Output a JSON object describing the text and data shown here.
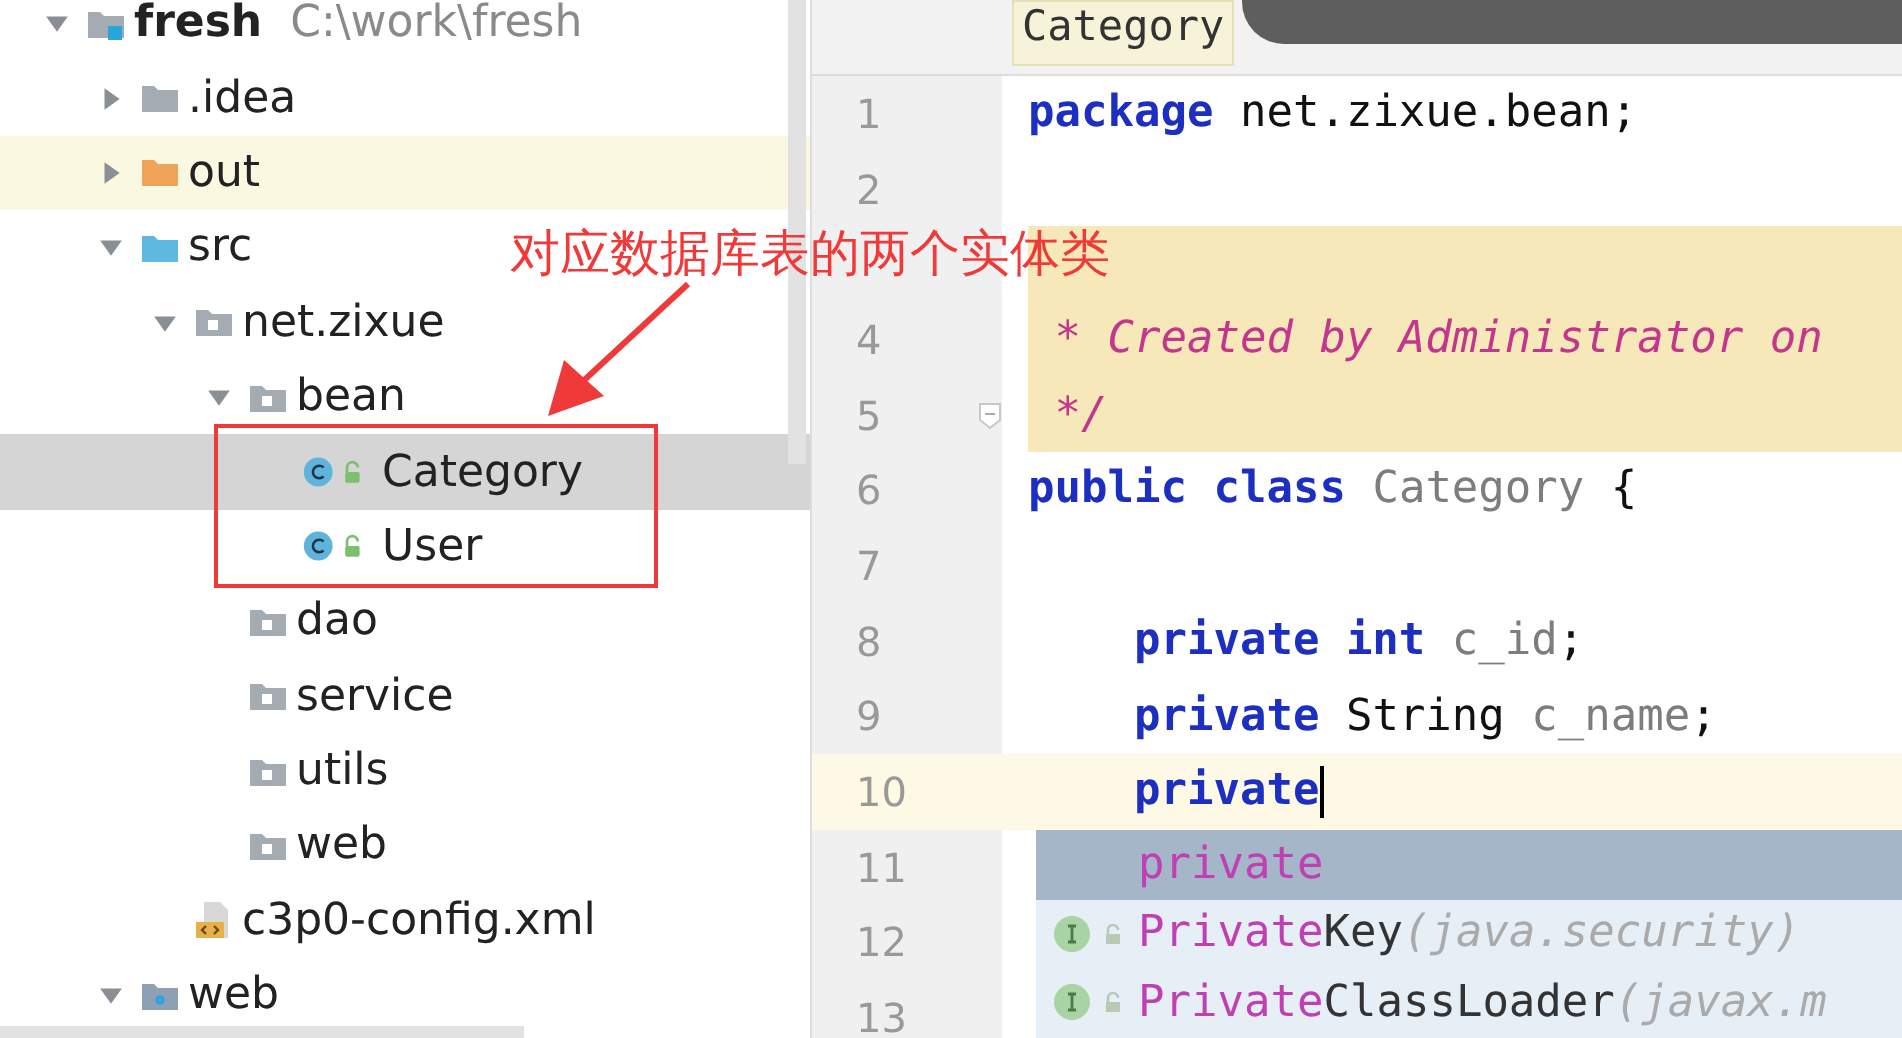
{
  "project_tree": {
    "name": "fresh",
    "path": "C:\\work\\fresh",
    "kind": "module",
    "expanded": true,
    "selected": false,
    "highlighted": false,
    "children": [
      {
        "name": ".idea",
        "kind": "folder",
        "expanded": false,
        "selected": false,
        "highlighted": false
      },
      {
        "name": "out",
        "kind": "excluded",
        "expanded": false,
        "selected": false,
        "highlighted": true
      },
      {
        "name": "src",
        "kind": "source",
        "expanded": true,
        "selected": false,
        "highlighted": false,
        "children": [
          {
            "name": "net.zixue",
            "kind": "package",
            "expanded": true,
            "selected": false,
            "highlighted": false,
            "children": [
              {
                "name": "bean",
                "kind": "package",
                "expanded": true,
                "selected": false,
                "highlighted": false,
                "children": [
                  {
                    "name": "Category",
                    "kind": "class",
                    "selected": true,
                    "highlighted": false
                  },
                  {
                    "name": "User",
                    "kind": "class",
                    "selected": false,
                    "highlighted": false
                  }
                ]
              },
              {
                "name": "dao",
                "kind": "package",
                "selected": false,
                "highlighted": false
              },
              {
                "name": "service",
                "kind": "package",
                "selected": false,
                "highlighted": false
              },
              {
                "name": "utils",
                "kind": "package",
                "selected": false,
                "highlighted": false
              },
              {
                "name": "web",
                "kind": "package",
                "selected": false,
                "highlighted": false
              }
            ]
          },
          {
            "name": "c3p0-config.xml",
            "kind": "xml",
            "selected": false,
            "highlighted": false
          }
        ]
      },
      {
        "name": "web",
        "kind": "web",
        "expanded": true,
        "selected": false,
        "highlighted": false
      }
    ]
  },
  "annotation": {
    "text": "对应数据库表的两个实体类"
  },
  "editor": {
    "tab": {
      "label": "Category",
      "selected": true
    },
    "lines": [
      {
        "number": "1",
        "current": false,
        "highlighted": false,
        "fold": false,
        "tokens": [
          {
            "text": "package",
            "kind": "keyword"
          },
          {
            "text": " net.zixue.bean;",
            "kind": "plain"
          }
        ]
      },
      {
        "number": "2",
        "current": false,
        "highlighted": false,
        "fold": false
      },
      {
        "current": false,
        "highlighted": true,
        "fold": false
      },
      {
        "number": "4",
        "current": false,
        "highlighted": true,
        "fold": false,
        "tokens": [
          {
            "text": " * Created by Administrator on",
            "kind": "comment"
          }
        ]
      },
      {
        "number": "5",
        "current": false,
        "highlighted": true,
        "fold": true,
        "tokens": [
          {
            "text": " */",
            "kind": "comment"
          }
        ]
      },
      {
        "number": "6",
        "current": false,
        "highlighted": false,
        "fold": false,
        "tokens": [
          {
            "text": "public class",
            "kind": "keyword"
          },
          {
            "text": " Category",
            "kind": "unused"
          },
          {
            "text": " {",
            "kind": "plain"
          }
        ]
      },
      {
        "number": "7",
        "current": false,
        "highlighted": false,
        "fold": false
      },
      {
        "number": "8",
        "current": false,
        "highlighted": false,
        "fold": false,
        "tokens": [
          {
            "text": "    private int",
            "kind": "keyword"
          },
          {
            "text": " c_id",
            "kind": "unused"
          },
          {
            "text": ";",
            "kind": "plain"
          }
        ]
      },
      {
        "number": "9",
        "current": false,
        "highlighted": false,
        "fold": false,
        "tokens": [
          {
            "text": "    private",
            "kind": "keyword"
          },
          {
            "text": " String ",
            "kind": "plain"
          },
          {
            "text": "c_name",
            "kind": "unused"
          },
          {
            "text": ";",
            "kind": "plain"
          }
        ]
      },
      {
        "number": "10",
        "current": true,
        "highlighted": false,
        "fold": false,
        "tokens": [
          {
            "text": "    private",
            "kind": "keyword"
          }
        ]
      },
      {
        "number": "11",
        "current": false,
        "highlighted": false,
        "fold": false
      },
      {
        "number": "12",
        "current": false,
        "highlighted": false,
        "fold": false
      },
      {
        "number": "13",
        "current": false,
        "highlighted": false,
        "fold": false
      }
    ]
  },
  "completion": [
    {
      "match": "private",
      "kind": "keyword",
      "selected": true
    },
    {
      "match": "Private",
      "rest": "Key",
      "hint": "(java.security)",
      "kind": "interface",
      "selected": false
    },
    {
      "match": "Private",
      "rest": "ClassLoader",
      "hint": "(javax.m",
      "kind": "interface",
      "selected": false
    }
  ]
}
